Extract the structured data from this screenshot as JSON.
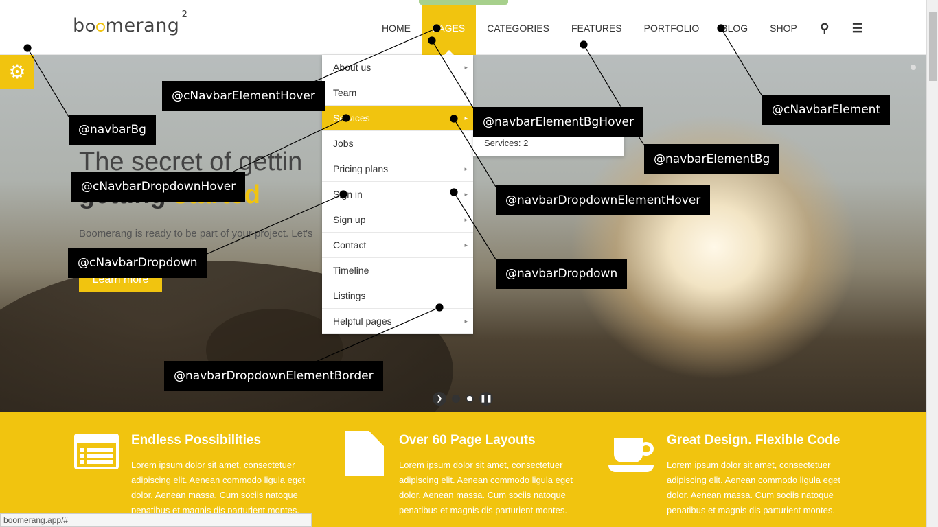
{
  "brand": {
    "logo_text_pre": "b",
    "logo_text_post": "merang",
    "logo_sup": "2"
  },
  "nav": [
    {
      "label": "HOME"
    },
    {
      "label": "PAGES",
      "active": true
    },
    {
      "label": "CATEGORIES"
    },
    {
      "label": "FEATURES"
    },
    {
      "label": "PORTFOLIO"
    },
    {
      "label": "BLOG"
    },
    {
      "label": "SHOP"
    }
  ],
  "nav_icons": {
    "search": "search-icon",
    "menu": "menu-icon"
  },
  "dropdown": {
    "items": [
      {
        "label": "About us",
        "has_sub": true
      },
      {
        "label": "Team",
        "has_sub": true
      },
      {
        "label": "Services",
        "has_sub": true,
        "hover": true
      },
      {
        "label": "Jobs",
        "has_sub": false
      },
      {
        "label": "Pricing plans",
        "has_sub": true
      },
      {
        "label": "Sign in",
        "has_sub": true
      },
      {
        "label": "Sign up",
        "has_sub": true
      },
      {
        "label": "Contact",
        "has_sub": true
      },
      {
        "label": "Timeline",
        "has_sub": false
      },
      {
        "label": "Listings",
        "has_sub": false
      },
      {
        "label": "Helpful pages",
        "has_sub": true
      }
    ],
    "submenu_label": "Services: 2"
  },
  "hero": {
    "title_line1": "The secret of gettin",
    "title_line2_pre": "getting ",
    "title_line2_hl": "started",
    "text": "Boomerang is ready to be part of your project. Let's",
    "button": "Learn more"
  },
  "features": [
    {
      "icon": "list-icon",
      "title": "Endless Possibilities",
      "text": "Lorem ipsum dolor sit amet, consectetuer adipiscing elit. Aenean commodo ligula eget dolor. Aenean massa. Cum sociis natoque penatibus et magnis dis parturient montes."
    },
    {
      "icon": "document-icon",
      "title": "Over 60 Page Layouts",
      "text": "Lorem ipsum dolor sit amet, consectetuer adipiscing elit. Aenean commodo ligula eget dolor. Aenean massa. Cum sociis natoque penatibus et magnis dis parturient montes."
    },
    {
      "icon": "coffee-cup-icon",
      "title": "Great Design. Flexible Code",
      "text": "Lorem ipsum dolor sit amet, consectetuer adipiscing elit. Aenean commodo ligula eget dolor. Aenean massa. Cum sociis natoque penatibus et magnis dis parturient montes."
    }
  ],
  "annotations": [
    {
      "label": "@navbarBg"
    },
    {
      "label": "@cNavbarElementHover"
    },
    {
      "label": "@cNavbarDropdownHover"
    },
    {
      "label": "@cNavbarDropdown"
    },
    {
      "label": "@navbarDropdownElementBorder"
    },
    {
      "label": "@navbarElementBgHover"
    },
    {
      "label": "@navbarElementBg"
    },
    {
      "label": "@cNavbarElement"
    },
    {
      "label": "@navbarDropdownElementHover"
    },
    {
      "label": "@navbarDropdown"
    }
  ],
  "status_url": "boomerang.app/#",
  "colors": {
    "accent": "#f1c40f",
    "annotation_bg": "#000000"
  }
}
